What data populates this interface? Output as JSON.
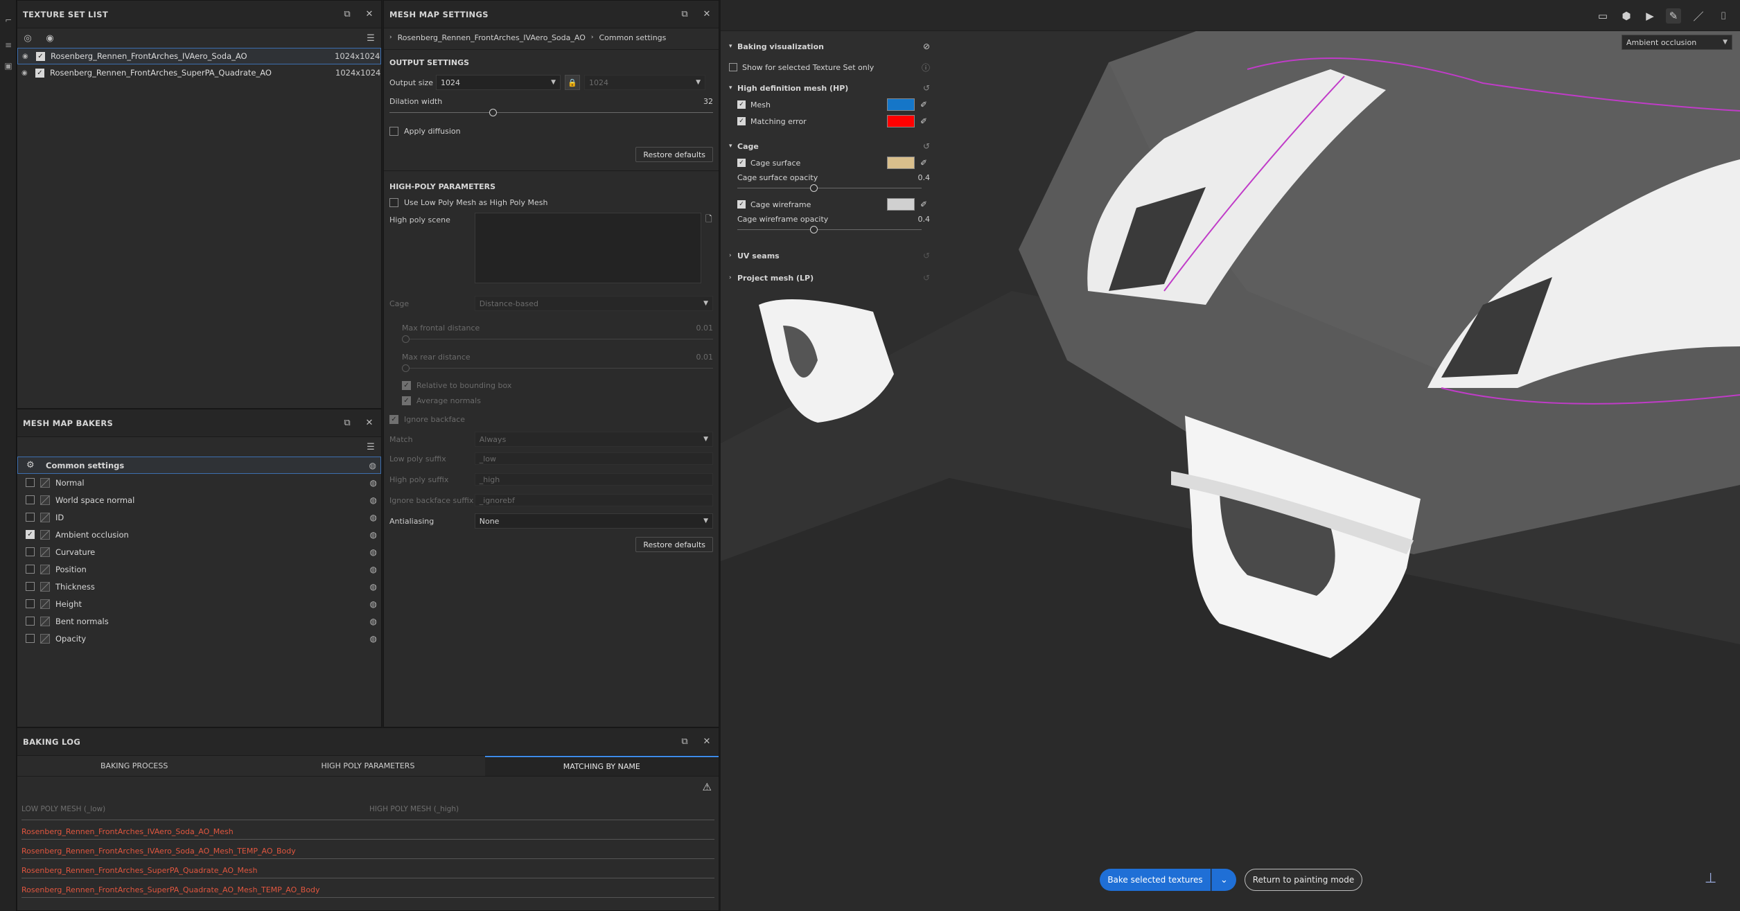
{
  "texture_set_list": {
    "title": "TEXTURE SET LIST",
    "items": [
      {
        "name": "Rosenberg_Rennen_FrontArches_IVAero_Soda_AO",
        "resolution": "1024x1024"
      },
      {
        "name": "Rosenberg_Rennen_FrontArches_SuperPA_Quadrate_AO",
        "resolution": "1024x1024"
      }
    ]
  },
  "mesh_map_bakers": {
    "title": "MESH MAP BAKERS",
    "common_settings": "Common settings",
    "items": [
      {
        "label": "Normal",
        "checked": false
      },
      {
        "label": "World space normal",
        "checked": false
      },
      {
        "label": "ID",
        "checked": false
      },
      {
        "label": "Ambient occlusion",
        "checked": true
      },
      {
        "label": "Curvature",
        "checked": false
      },
      {
        "label": "Position",
        "checked": false
      },
      {
        "label": "Thickness",
        "checked": false
      },
      {
        "label": "Height",
        "checked": false
      },
      {
        "label": "Bent normals",
        "checked": false
      },
      {
        "label": "Opacity",
        "checked": false
      }
    ]
  },
  "mesh_map_settings": {
    "title": "MESH MAP SETTINGS",
    "breadcrumb_set": "Rosenberg_Rennen_FrontArches_IVAero_Soda_AO",
    "breadcrumb_page": "Common settings",
    "output_settings": "OUTPUT SETTINGS",
    "output_size_label": "Output size",
    "output_size_value": "1024",
    "output_size_value2": "1024",
    "dilation_label": "Dilation width",
    "dilation_value": "32",
    "dilation_fraction": 0.32,
    "apply_diffusion": "Apply diffusion",
    "restore_defaults": "Restore defaults",
    "high_poly_params": "HIGH-POLY PARAMETERS",
    "use_low_poly": "Use Low Poly Mesh as High Poly Mesh",
    "high_poly_scene": "High poly scene",
    "cage_label": "Cage",
    "cage_value": "Distance-based",
    "max_frontal": "Max frontal distance",
    "max_frontal_value": "0.01",
    "max_rear": "Max rear distance",
    "max_rear_value": "0.01",
    "relative_bbox": "Relative to bounding box",
    "average_normals": "Average normals",
    "ignore_backface": "Ignore backface",
    "match_label": "Match",
    "match_value": "Always",
    "low_poly_suffix_label": "Low poly suffix",
    "low_poly_suffix_value": "_low",
    "high_poly_suffix_label": "High poly suffix",
    "high_poly_suffix_value": "_high",
    "ignore_backface_suffix_label": "Ignore backface suffix",
    "ignore_backface_suffix_value": "_ignorebf",
    "antialiasing_label": "Antialiasing",
    "antialiasing_value": "None",
    "restore_defaults_2": "Restore defaults"
  },
  "baking_log": {
    "title": "BAKING LOG",
    "tabs": [
      "BAKING PROCESS",
      "HIGH POLY PARAMETERS",
      "MATCHING BY NAME"
    ],
    "col_low": "LOW POLY MESH (_low)",
    "col_high": "HIGH POLY MESH (_high)",
    "rows": [
      "Rosenberg_Rennen_FrontArches_IVAero_Soda_AO_Mesh",
      "Rosenberg_Rennen_FrontArches_IVAero_Soda_AO_Mesh_TEMP_AO_Body",
      "Rosenberg_Rennen_FrontArches_SuperPA_Quadrate_AO_Mesh",
      "Rosenberg_Rennen_FrontArches_SuperPA_Quadrate_AO_Mesh_TEMP_AO_Body"
    ]
  },
  "baking_visualization": {
    "title": "Baking visualization",
    "show_selected": "Show for selected Texture Set only",
    "hp_section": "High definition mesh (HP)",
    "mesh": "Mesh",
    "mesh_color": "#1576c8",
    "matching_error": "Matching error",
    "matching_error_color": "#ff0000",
    "cage_section": "Cage",
    "cage_surface": "Cage surface",
    "cage_surface_color": "#d9bf8c",
    "cage_surface_opacity_label": "Cage surface opacity",
    "cage_surface_opacity": "0.4",
    "cage_wireframe": "Cage wireframe",
    "cage_wireframe_color": "#d0d0d0",
    "cage_wireframe_opacity_label": "Cage wireframe opacity",
    "cage_wireframe_opacity": "0.4",
    "uv_seams": "UV seams",
    "project_mesh": "Project mesh (LP)"
  },
  "viewport": {
    "channel_select": "Ambient occlusion",
    "bake_button": "Bake selected textures",
    "return_button": "Return to painting mode"
  }
}
